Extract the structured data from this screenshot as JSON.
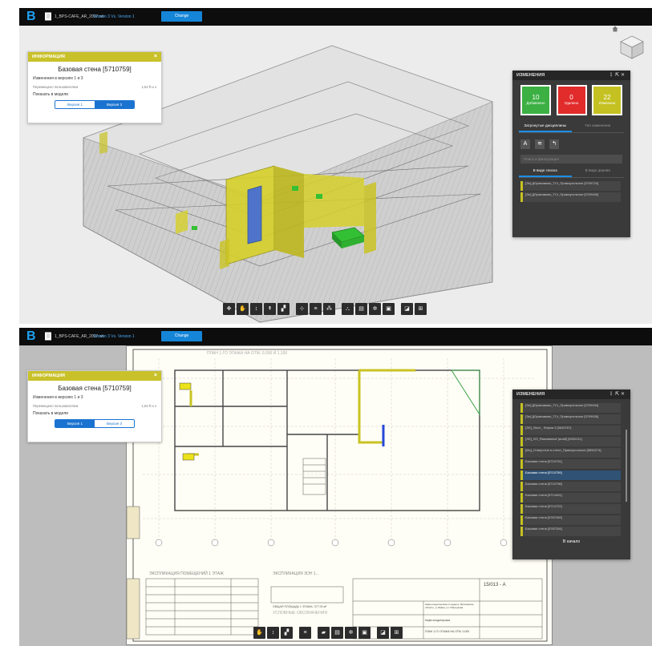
{
  "top": {
    "file_name": "1_BPS-CAFE_AR_2017.rvt",
    "version_label": "Version 3 Vs. Version 1",
    "change_button": "Change",
    "info": {
      "title": "ИНФОРМАЦИЯ",
      "element": "Базовая стена [5710759]",
      "changes": "Изменения в версиях 1 и 3",
      "prop": "Перемещено пользователем",
      "prop_value": "1,64 ft и э",
      "show": "Показать в модели",
      "v1": "Версия 1",
      "v3": "Версия 3"
    },
    "changes": {
      "title": "ИЗМЕНЕНИЯ",
      "added_n": "10",
      "added": "Добавлено",
      "removed_n": "0",
      "removed": "Удалено",
      "modified_n": "22",
      "modified": "Изменено",
      "tab1": "Затронутые дисциплины",
      "tab2": "Тип изменения",
      "search": "Поиск и фильтрация",
      "view1": "В виде списка",
      "view2": "В виде дерева",
      "items": [
        "[Эл] ДОрмсквимо_ТСг_Прямоугольное [5709724]",
        "[Эл] ДОрмсквимо_ТСг_Прямоугольное [5709490]"
      ]
    }
  },
  "bottom": {
    "file_name": "1_BPS-CAFE_AR_2017.rvt",
    "version_label": "Version 3 Vs. Version 1",
    "change_button": "Change",
    "info": {
      "title": "ИНФОРМАЦИЯ",
      "element": "Базовая стена [5710759]",
      "changes": "Изменения в версиях 1 и 3",
      "prop": "Перемещено пользователем",
      "prop_value": "1,64 ft и э",
      "show": "Показать в модели",
      "v1": "Версия 1",
      "v3": "Версия 3"
    },
    "changes": {
      "title": "ИЗМЕНЕНИЯ",
      "items": [
        "[Эл] ДОрмсквимо_ТСг_Прямоугольное [5709494]",
        "[Эл] ДОрмсквимо_ТСг_Прямоугольное [5709926]",
        "[ЭЛ]_Люст_ Форма 3 [5643767]",
        "[ЭЛ]_ЛО_Равсвиння2 [инаб] [5902211]",
        "[Мо]_Отверстие в стене_Прямоугольное [5650274]",
        "Базовая стена [5710731]",
        "Базовая стена [5710759]",
        "Базовая стена [5710798]",
        "Базовая стена [5714491]",
        "Базовая стена [5714722]",
        "Базовая стена [5787269]",
        "Базовая стена [5787254]"
      ],
      "selected_index": 6,
      "back": "В начало"
    },
    "sheet": {
      "plan_title": "ПЛАН 1-ГО ЭТАЖА НА ОТМ. 0,000 И 1,100",
      "expl1": "ЭКСПЛИКАЦИЯ ПОМЕЩЕНИЙ 1 ЭТАЖ",
      "expl2": "ЭКСПЛИКАЦИЯ ЗОН 1...",
      "legend": "УСЛОВНЫЕ ОБОЗНАЧЕНИЯ",
      "stamp_code": "15/013 - А",
      "stamp_obj": "Кафе-кондитерская по адресу: Московская область, д. Бавна, ул. Павлушева",
      "stamp_name": "Кафе-кондитерская",
      "stamp_sheet": "ПЛАН 1-ГО ЭТАЖА НА ОТМ. 0,000",
      "total_area": "ОБЩАЯ ПЛОЩАДЬ 1 ЭТАЖА: 377.00 м²"
    }
  }
}
